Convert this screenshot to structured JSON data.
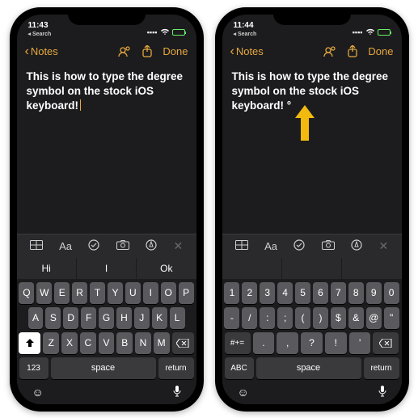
{
  "phoneA": {
    "status": {
      "time": "11:43",
      "search": "◂ Search"
    },
    "nav": {
      "back": "Notes",
      "done": "Done"
    },
    "note": "This is how to type the degree symbol on the stock iOS keyboard!",
    "suggestions": [
      "Hi",
      "I",
      "Ok"
    ],
    "kb": {
      "r1": [
        "Q",
        "W",
        "E",
        "R",
        "T",
        "Y",
        "U",
        "I",
        "O",
        "P"
      ],
      "r2": [
        "A",
        "S",
        "D",
        "F",
        "G",
        "H",
        "J",
        "K",
        "L"
      ],
      "r3": [
        "Z",
        "X",
        "C",
        "V",
        "B",
        "N",
        "M"
      ],
      "mode": "123",
      "space": "space",
      "ret": "return"
    }
  },
  "phoneB": {
    "status": {
      "time": "11:44",
      "search": "◂ Search"
    },
    "nav": {
      "back": "Notes",
      "done": "Done"
    },
    "note": "This is how to type the degree symbol on the stock iOS keyboard!   °",
    "suggestions": [
      "",
      "",
      ""
    ],
    "kb": {
      "r1": [
        "1",
        "2",
        "3",
        "4",
        "5",
        "6",
        "7",
        "8",
        "9",
        "0"
      ],
      "r2": [
        "-",
        "/",
        ":",
        ";",
        "(",
        ")",
        "$",
        "&",
        "@",
        "\""
      ],
      "r3": [
        ".",
        ",",
        "?",
        "!",
        "'"
      ],
      "mode": "ABC",
      "hash": "#+=",
      "space": "space",
      "ret": "return"
    }
  },
  "colors": {
    "accent": "#e6a83e"
  }
}
